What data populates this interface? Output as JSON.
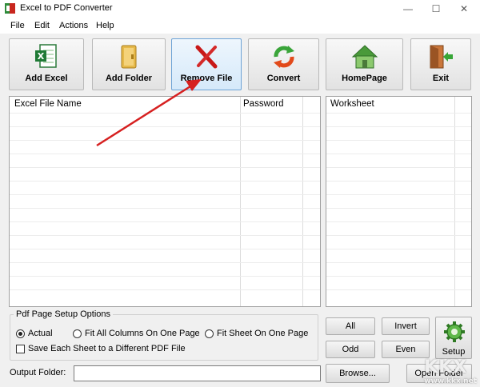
{
  "window": {
    "title": "Excel to PDF Converter"
  },
  "menu": [
    "File",
    "Edit",
    "Actions",
    "Help"
  ],
  "toolbar": {
    "add_excel": "Add Excel",
    "add_folder": "Add Folder",
    "remove_file": "Remove File",
    "convert": "Convert",
    "homepage": "HomePage",
    "exit": "Exit"
  },
  "file_list": {
    "col_name": "Excel File Name",
    "col_password": "Password"
  },
  "worksheet_list": {
    "col_worksheet": "Worksheet"
  },
  "page_setup": {
    "title": "Pdf Page Setup Options",
    "opt_actual": "Actual",
    "opt_fit_columns": "Fit All Columns On One Page",
    "opt_fit_sheet": "Fit Sheet On One Page",
    "selected": "Actual",
    "save_each_sheet": "Save Each Sheet to a Different PDF File",
    "save_each_sheet_checked": false
  },
  "sheet_buttons": {
    "all": "All",
    "invert": "Invert",
    "odd": "Odd",
    "even": "Even",
    "setup": "Setup"
  },
  "output": {
    "label": "Output Folder:",
    "value": "",
    "browse": "Browse...",
    "open_folder": "Open Folder"
  },
  "watermark": {
    "main": "KKX",
    "sub": "www.kkx.net"
  },
  "colors": {
    "arrow": "#d62020",
    "highlight_border": "#6ea3d6"
  }
}
